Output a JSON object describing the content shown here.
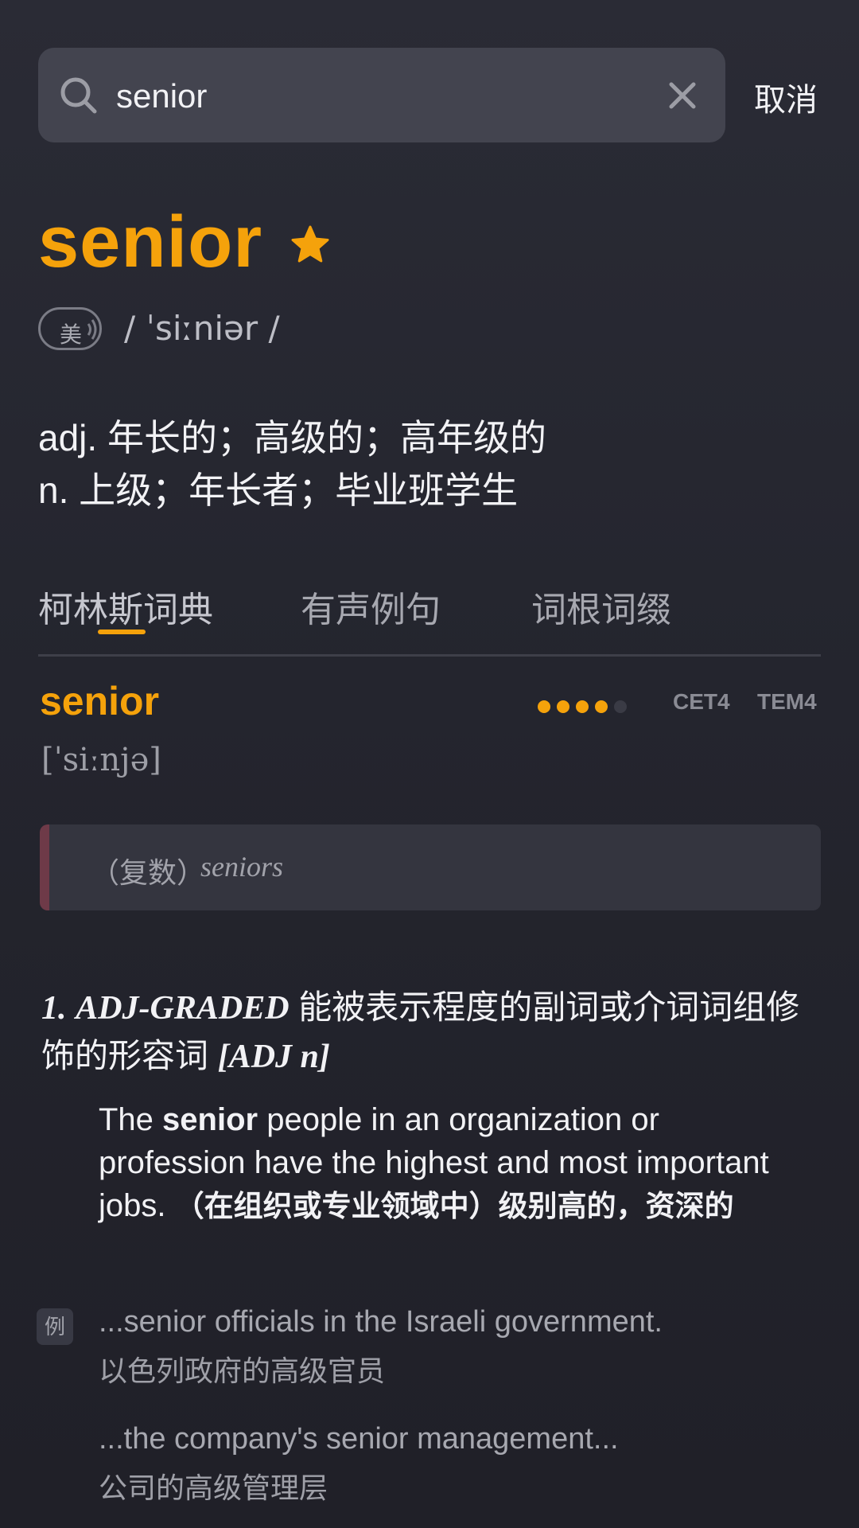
{
  "search": {
    "value": "senior",
    "cancel_label": "取消"
  },
  "word": {
    "headword": "senior",
    "accent_label": "美",
    "phonetic": "/  ˈsiːniər  /",
    "definitions": [
      "adj. 年长的；高级的；高年级的",
      "n. 上级；年长者；毕业班学生"
    ]
  },
  "tabs": [
    {
      "label": "柯林斯词典",
      "active": true
    },
    {
      "label": "有声例句",
      "active": false
    },
    {
      "label": "词根词缀",
      "active": false
    }
  ],
  "entry": {
    "word": "senior",
    "frequency": "4/5",
    "levels": [
      "CET4",
      "TEM4"
    ],
    "phonetic": "[ˈsiːnjə]",
    "inflection": {
      "label": "（复数）",
      "word": "seniors"
    },
    "sense": {
      "number": "1.",
      "pos": "ADJ-GRADED",
      "pos_cn": "能被表示程度的副词或介词词组修饰的形容词",
      "pattern": "[ADJ n]",
      "def_prefix": "The ",
      "def_keyword": "senior",
      "def_rest": " people in an organization or profession have the highest and most important jobs.",
      "def_cn": "（在组织或专业领域中）级别高的，资深的"
    },
    "example_tag": "例",
    "examples": [
      {
        "en": "...senior officials in the Israeli government.",
        "zh": "以色列政府的高级官员"
      },
      {
        "en": "...the company's senior management...",
        "zh": "公司的高级管理层"
      }
    ]
  },
  "colors": {
    "accent": "#f5a20b",
    "background": "#262731",
    "search_bg": "#43444f"
  },
  "icons": {
    "search": "search-icon",
    "clear": "close-icon",
    "favorite": "star-icon",
    "audio": "speaker-wave-icon"
  }
}
